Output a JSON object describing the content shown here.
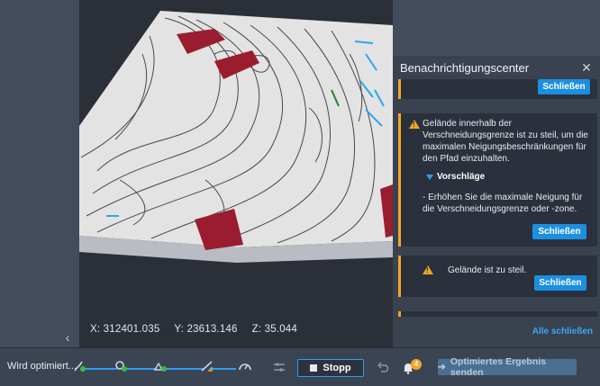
{
  "notification_center": {
    "title": "Benachrichtigungscenter",
    "top_close_label": "Schließen",
    "card1_message": "Gelände innerhalb der Verschneidungsgrenze ist zu steil, um die maximalen Neigungsbeschränkungen für den Pfad einzuhalten.",
    "suggestions_label": "Vorschläge",
    "suggestion_text": "- Erhöhen Sie die maximale Neigung für die Verschneidungsgrenze oder -zone.",
    "card1_close_label": "Schließen",
    "card2_message": "Gelände ist zu steil.",
    "card2_close_label": "Schließen",
    "close_all_label": "Alle schließen"
  },
  "viewport": {
    "coord_x": "X: 312401.035",
    "coord_y": "Y: 23613.146",
    "coord_z": "Z: 35.044"
  },
  "bottom_bar": {
    "status_label": "Wird optimiert...",
    "stop_label": "Stopp",
    "notification_count": "4",
    "send_result_label": "Optimiertes Ergebnis senden"
  },
  "colors": {
    "accent": "#1c8fe0",
    "warning": "#f5a623",
    "panel": "#3a4250",
    "card": "#2a313c",
    "building": "#9b1c2e"
  },
  "icons": [
    "chevron-left-icon",
    "close-icon",
    "warning-icon",
    "triangle-down-icon",
    "settings-sliders-icon",
    "stop-icon",
    "undo-icon",
    "bell-icon",
    "send-arrow-icon",
    "speedometer-icon"
  ]
}
